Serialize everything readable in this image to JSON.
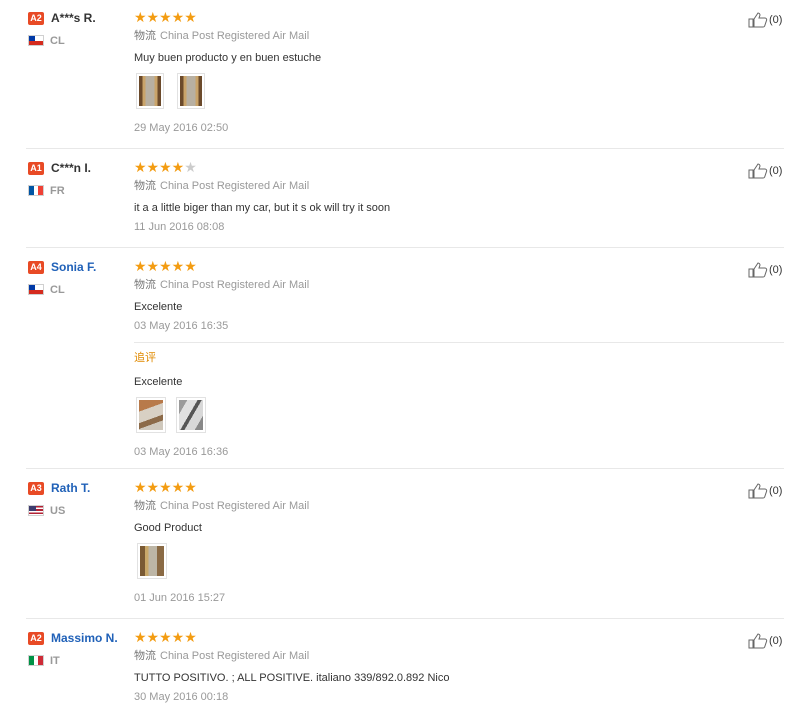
{
  "logistics_label": "物流",
  "followup_label": "追评",
  "reviews": [
    {
      "level": "A2",
      "user": "A***s R.",
      "country": "CL",
      "stars": 5,
      "shipping": "China Post Registered Air Mail",
      "text": "Muy buen producto y en buen estuche",
      "date": "29 May 2016 02:50",
      "helpful": "(0)"
    },
    {
      "level": "A1",
      "user": "C***n I.",
      "country": "FR",
      "stars": 4,
      "shipping": "China Post Registered Air Mail",
      "text": "it a a little biger than my car, but it s ok will try it soon",
      "date": "11 Jun 2016 08:08",
      "helpful": "(0)"
    },
    {
      "level": "A4",
      "user": "Sonia F.",
      "country": "CL",
      "stars": 5,
      "shipping": "China Post Registered Air Mail",
      "text": "Excelente",
      "date": "03 May 2016 16:35",
      "followup_text": "Excelente",
      "followup_date": "03 May 2016 16:36",
      "helpful": "(0)"
    },
    {
      "level": "A3",
      "user": "Rath T.",
      "country": "US",
      "stars": 5,
      "shipping": "China Post Registered Air Mail",
      "text": "Good Product",
      "date": "01 Jun 2016 15:27",
      "helpful": "(0)"
    },
    {
      "level": "A2",
      "user": "Massimo N.",
      "country": "IT",
      "stars": 5,
      "shipping": "China Post Registered Air Mail",
      "text": "TUTTO POSITIVO. ; ALL POSITIVE. italiano 339/892.0.892 Nico",
      "date": "30 May 2016 00:18",
      "helpful": "(0)"
    }
  ]
}
